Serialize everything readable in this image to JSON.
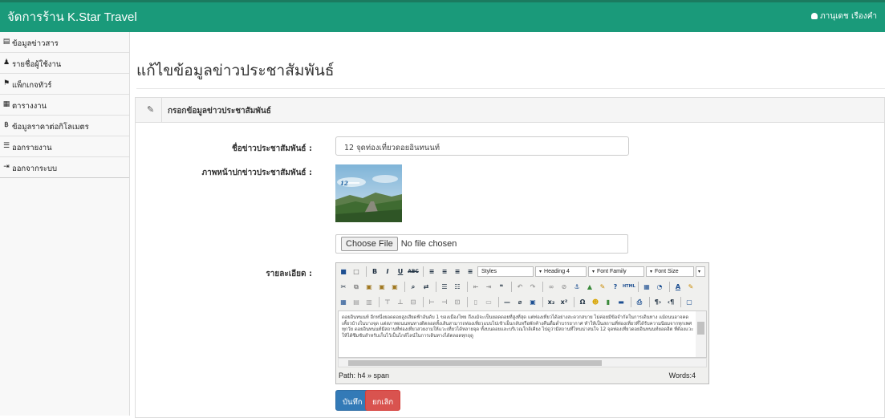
{
  "header": {
    "brand": "จัดการร้าน K.Star Travel",
    "user_name": "ภานุเดช เรืองคำ",
    "bg_color": "#1a9a7a"
  },
  "sidebar": {
    "items": [
      {
        "icon": "newspaper-icon",
        "glyph": "▤",
        "label": "ข้อมูลข่าวสาร"
      },
      {
        "icon": "user-icon",
        "glyph": "♟",
        "label": "รายชื่อผู้ใช้งาน"
      },
      {
        "icon": "flag-icon",
        "glyph": "⚑",
        "label": "แพ็กเกจทัวร์"
      },
      {
        "icon": "calendar-icon",
        "glyph": "▦",
        "label": "ตารางงาน"
      },
      {
        "icon": "baht-icon",
        "glyph": "฿",
        "label": "ข้อมูลราคาต่อกิโลเมตร"
      },
      {
        "icon": "list-icon",
        "glyph": "☰",
        "label": "ออกรายงาน"
      },
      {
        "icon": "sign-out-icon",
        "glyph": "⇥",
        "label": "ออกจากระบบ"
      }
    ]
  },
  "page": {
    "title": "แก้ไขข้อมูลข่าวประชาสัมพันธ์",
    "panel_title": "กรอกข้อมูลข่าวประชาสัมพันธ์"
  },
  "form": {
    "name_label": "ชื่อข่าวประชาสัมพันธ์ :",
    "name_value": "12 จุดท่องเที่ยวดอยอินทนนท์",
    "image_label": "ภาพหน้าปกข่าวประชาสัมพันธ์ :",
    "file_button": "Choose File",
    "file_status": "No file chosen",
    "detail_label": "รายละเอียด :",
    "editor": {
      "styles": "Styles",
      "heading": "Heading 4",
      "font_family": "Font Family",
      "font_size": "Font Size",
      "body": "ดอยอินทนนท์ อีกหนึ่งยอดดอยสูงเสียดฟ้าอันดับ 1 ของเมืองไทย ถึงแม้จะเป็นยอดดอยที่สูงที่สุด แต่ท่องเที่ยวได้อย่างสะดวกสบาย ไม่ค่อยมีข้อจำกัดในการเดินทาง แม้ถนนอาจคดเคี้ยวบ้างในบางจุด แต่สภาพถนนหนทางดีตลอดทั้งเส้นสามารถท่องเที่ยวแบบไปเช้าเย็นกลับหรือพักค้างคืนดื่มด่ำบรรยากาศ ทำให้เป็นสถานที่ท่องเที่ยวที่ได้รับความนิยมจากทุกเพศทุกวัย ดอยอินทนนท์มีสถานที่ท่องเที่ยวสวยงามให้แวะเที่ยวได้หลายจุด ทั้งบนดอยและบริเวณใกล้เคียง ไปดูว่ามีสถานที่ไหนน่าสนใจ 12 จุดท่องเที่ยวดอยอินทนนท์ยอดฮิต ที่ต้องแวะให้ได้ซึมซับสำหรับเก็บไว้เป็นไกด์ไลน์ในการเดินทางได้ตลอดทุกฤดู",
      "path": "Path: h4 » span",
      "words": "Words:4"
    },
    "save_button": "บันทึก",
    "cancel_button": "ยกเลิก",
    "save_color": "#337ab7",
    "cancel_color": "#d9534f"
  }
}
